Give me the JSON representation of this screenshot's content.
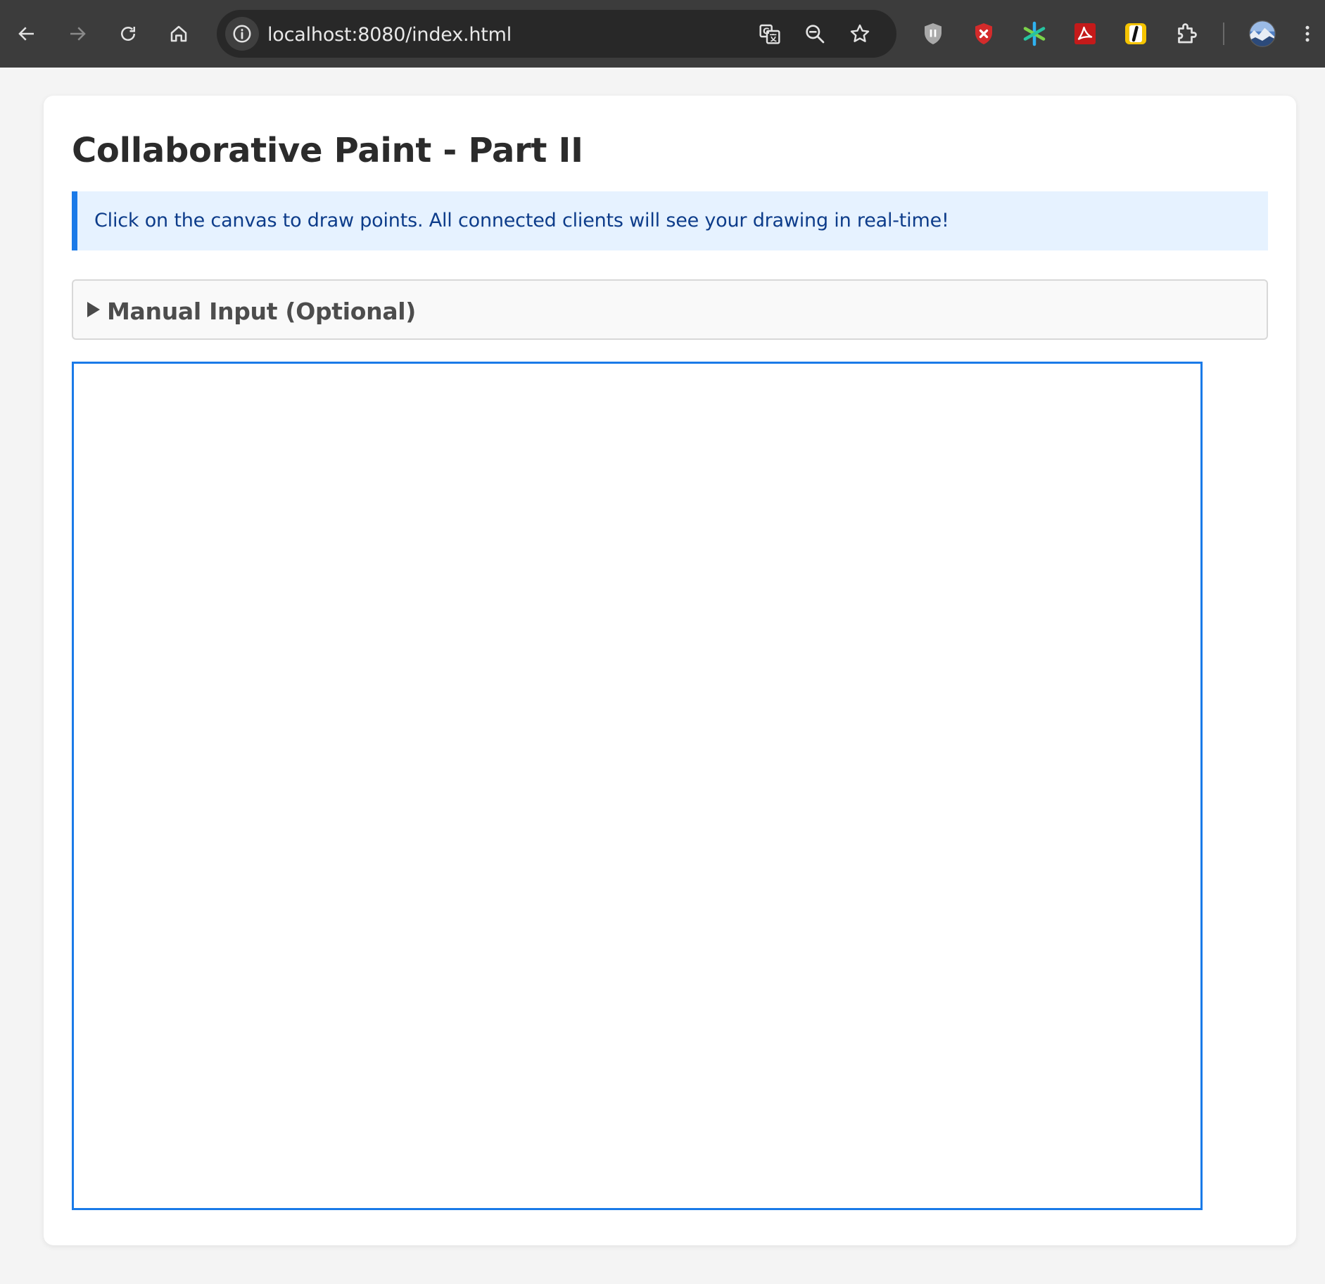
{
  "browser": {
    "url": "localhost:8080/index.html",
    "icons": {
      "back": "arrow-left-icon",
      "forward": "arrow-right-icon",
      "reload": "reload-icon",
      "home": "home-icon",
      "site_info": "info-icon",
      "translate": "translate-icon",
      "zoom": "zoom-icon",
      "bookmark": "star-icon",
      "extensions": [
        "shield-extension",
        "red-shield-extension",
        "asterisk-extension",
        "pdf-extension",
        "yellow-l-extension",
        "puzzle-extensions"
      ],
      "profile": "profile-avatar",
      "menu": "kebab-menu-icon"
    }
  },
  "page": {
    "title": "Collaborative Paint - Part II",
    "info_message": "Click on the canvas to draw points. All connected clients will see your drawing in real-time!",
    "manual_input_label": "Manual Input (Optional)"
  },
  "colors": {
    "accent": "#1a7ae8",
    "banner_background": "#e6f2ff",
    "banner_text": "#0d3c8a",
    "page_background": "#f4f4f4",
    "chrome_background": "#3c3c3c"
  }
}
